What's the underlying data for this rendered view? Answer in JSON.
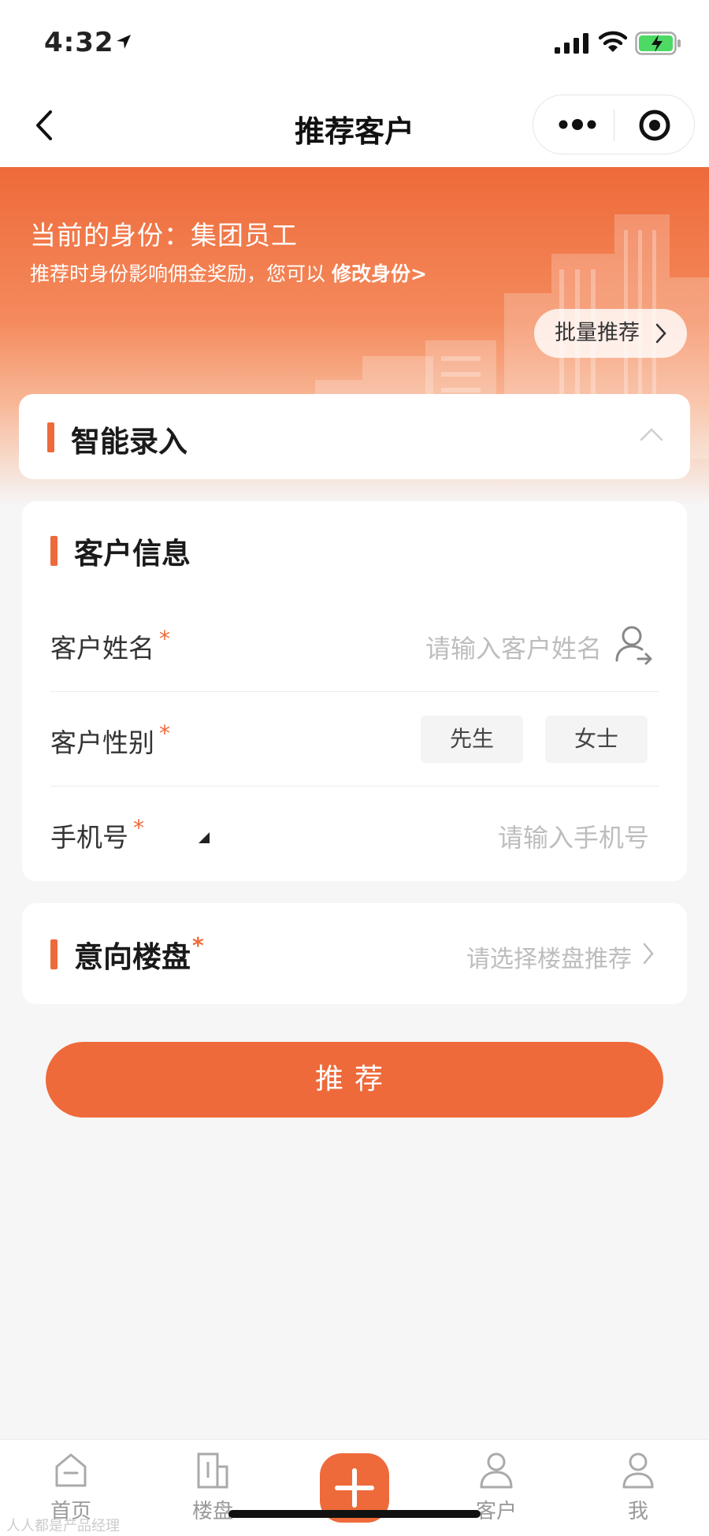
{
  "status_bar": {
    "time": "4:32"
  },
  "nav": {
    "title": "推荐客户"
  },
  "hero": {
    "identity": "当前的身份：集团员工",
    "hint_prefix": "推荐时身份影响佣金奖励，您可以",
    "hint_link": "修改身份>",
    "batch_label": "批量推荐"
  },
  "smart_entry": {
    "title": "智能录入"
  },
  "customer_info": {
    "title": "客户信息",
    "name": {
      "label": "客户姓名",
      "required": "*",
      "placeholder": "请输入客户姓名"
    },
    "gender": {
      "label": "客户性别",
      "required": "*",
      "options": [
        "先生",
        "女士"
      ]
    },
    "phone": {
      "label": "手机号",
      "required": "*",
      "placeholder": "请输入手机号"
    }
  },
  "project": {
    "title": "意向楼盘",
    "required": "*",
    "placeholder": "请选择楼盘推荐"
  },
  "submit": {
    "label": "推荐"
  },
  "tabs": [
    {
      "label": "首页"
    },
    {
      "label": "楼盘"
    },
    {
      "label": "客户"
    },
    {
      "label": "我"
    }
  ],
  "colors": {
    "accent": "#ee6a3a",
    "placeholder": "#bdbdbd"
  },
  "watermark": "人人都是产品经理"
}
